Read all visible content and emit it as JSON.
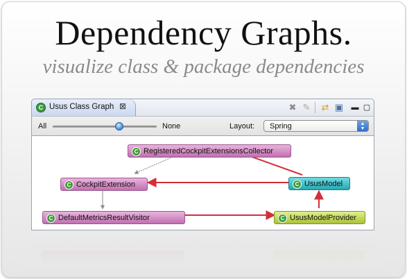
{
  "hero": {
    "title": "Dependency Graphs.",
    "subtitle": "visualize class & package dependencies"
  },
  "view": {
    "tab": {
      "label": "Usus Class Graph",
      "icon": "class-icon",
      "close_icon": "close-icon"
    },
    "toolbar_icons": [
      "delete-icon",
      "eraser-icon",
      "sync-icon",
      "save-icon",
      "minimize-icon",
      "maximize-icon"
    ],
    "controls": {
      "slider_min_label": "All",
      "slider_max_label": "None",
      "slider_value": 0.64,
      "layout_label": "Layout:",
      "layout_value": "Spring"
    }
  },
  "graph": {
    "nodes": [
      {
        "id": "registered",
        "label": "RegisteredCockpitExtensionsCollector",
        "color": "#c27ab6"
      },
      {
        "id": "cockpit",
        "label": "CockpitExtension",
        "color": "#c27ab6"
      },
      {
        "id": "usus",
        "label": "UsusModel",
        "color": "#30b1bd"
      },
      {
        "id": "default",
        "label": "DefaultMetricsResultVisitor",
        "color": "#c27ab6"
      },
      {
        "id": "provider",
        "label": "UsusModelProvider",
        "color": "#b1c74a"
      }
    ],
    "edges": [
      {
        "from": "registered",
        "to": "cockpit",
        "color": "#888888"
      },
      {
        "from": "usus",
        "to": "registered",
        "color": "#d32f3a"
      },
      {
        "from": "usus",
        "to": "cockpit",
        "color": "#d32f3a"
      },
      {
        "from": "cockpit",
        "to": "default",
        "color": "#888888"
      },
      {
        "from": "default",
        "to": "provider",
        "color": "#d32f3a"
      },
      {
        "from": "provider",
        "to": "usus",
        "color": "#d32f3a"
      }
    ]
  },
  "colors": {
    "accent": "#2f6fc7",
    "edge_red": "#d32f3a",
    "edge_gray": "#888888"
  }
}
